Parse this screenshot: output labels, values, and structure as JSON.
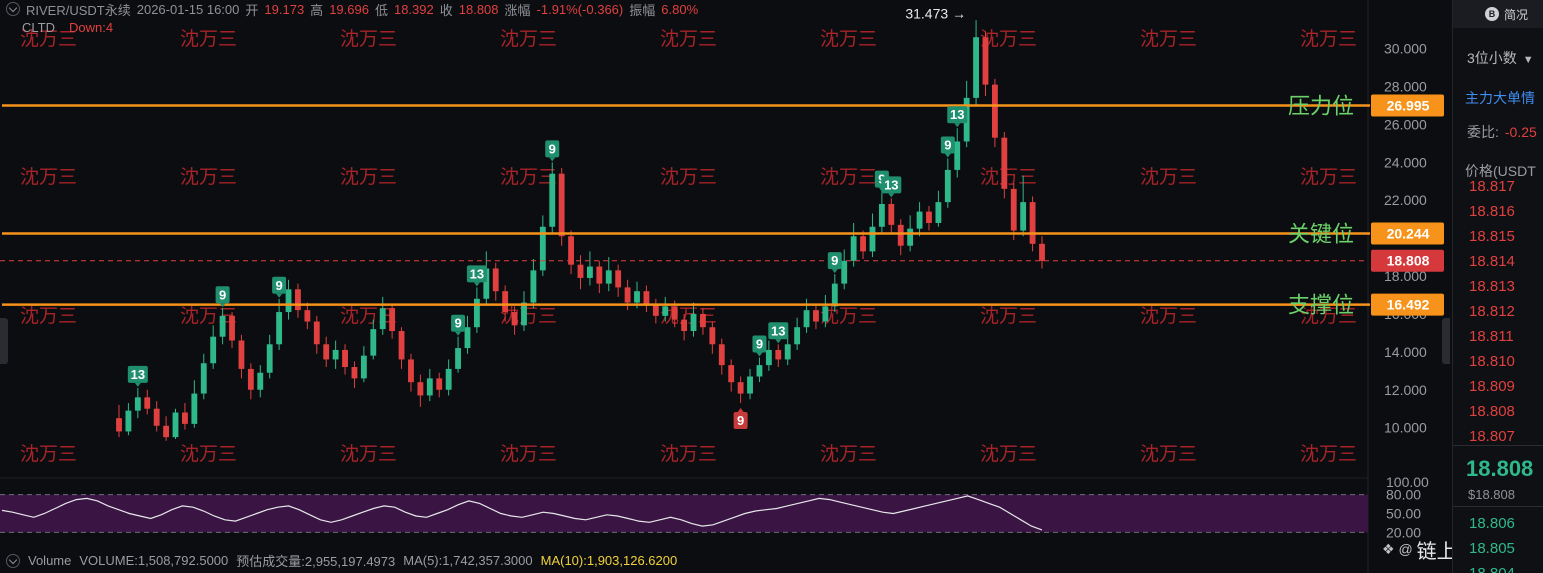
{
  "header": {
    "symbol": "RIVER/USDT永续",
    "datetime": "2026-01-15 16:00",
    "open_label": "开",
    "open": "19.173",
    "high_label": "高",
    "high": "19.696",
    "low_label": "低",
    "low": "18.392",
    "close_label": "收",
    "close": "18.808",
    "change_label": "涨幅",
    "change": "-1.91%(-0.366)",
    "amp_label": "振幅",
    "amp": "6.80%"
  },
  "indicator": {
    "name": "CLTD",
    "down": "Down:4"
  },
  "volume": {
    "label": "Volume",
    "volume": "VOLUME:1,508,792.5000",
    "est": "预估成交量:2,955,197.4973",
    "ma5": "MA(5):1,742,357.3000",
    "ma10": "MA(10):1,903,126.6200"
  },
  "watermark": "沈万三",
  "brand": "链上城主",
  "right_panel": {
    "top_button": "简况",
    "decimals": "3位小数",
    "main_order": "主力大单情",
    "weibi_label": "委比:",
    "weibi_value": "-0.25",
    "price_header": "价格(USDT",
    "asks": [
      "18.817",
      "18.816",
      "18.815",
      "18.814",
      "18.813",
      "18.812",
      "18.811",
      "18.810",
      "18.809",
      "18.808",
      "18.807"
    ],
    "last_price": "18.808",
    "last_usd": "$18.808",
    "bids": [
      "18.806",
      "18.805",
      "18.804"
    ]
  },
  "colors": {
    "up": "#2fb98a",
    "down": "#e0403f",
    "level": "#f7931a",
    "rsi_fill": "#3a1442"
  },
  "chart_data": {
    "type": "candlestick",
    "ylim": [
      8.4,
      32.3
    ],
    "price_ticks": [
      "30.000",
      "28.000",
      "26.000",
      "24.000",
      "22.000",
      "20.000",
      "18.000",
      "16.000",
      "14.000",
      "12.000",
      "10.000"
    ],
    "levels": [
      {
        "label": "压力位",
        "value": 26.995,
        "text": "26.995"
      },
      {
        "label": "关键位",
        "value": 20.244,
        "text": "20.244"
      },
      {
        "label": "支撑位",
        "value": 16.492,
        "text": "16.492"
      }
    ],
    "current": {
      "value": 18.808,
      "text": "18.808"
    },
    "high_marker": {
      "text": "31.473 →",
      "value": 31.473
    },
    "candles": [
      [
        0,
        10.5,
        9.8,
        11.2,
        9.5
      ],
      [
        1,
        9.8,
        10.9,
        11.3,
        9.6
      ],
      [
        2,
        10.9,
        11.6,
        12.1,
        10.5
      ],
      [
        3,
        11.6,
        11.0,
        12.0,
        10.7
      ],
      [
        4,
        11.0,
        10.1,
        11.4,
        9.8
      ],
      [
        5,
        10.1,
        9.5,
        10.6,
        9.3
      ],
      [
        6,
        9.5,
        10.8,
        11.0,
        9.4
      ],
      [
        7,
        10.8,
        10.2,
        11.3,
        9.9
      ],
      [
        8,
        10.2,
        11.8,
        12.5,
        10.0
      ],
      [
        9,
        11.8,
        13.4,
        13.9,
        11.5
      ],
      [
        10,
        13.4,
        14.8,
        15.4,
        13.1
      ],
      [
        11,
        14.8,
        15.9,
        16.3,
        14.4
      ],
      [
        12,
        15.9,
        14.6,
        16.1,
        14.2
      ],
      [
        13,
        14.6,
        13.1,
        14.9,
        12.6
      ],
      [
        14,
        13.1,
        12.0,
        13.4,
        11.5
      ],
      [
        15,
        12.0,
        12.9,
        13.3,
        11.6
      ],
      [
        16,
        12.9,
        14.4,
        14.9,
        12.6
      ],
      [
        17,
        14.4,
        16.1,
        16.8,
        14.1
      ],
      [
        18,
        16.1,
        17.3,
        17.8,
        15.7
      ],
      [
        19,
        17.3,
        16.2,
        17.6,
        15.8
      ],
      [
        20,
        16.2,
        15.6,
        16.6,
        15.2
      ],
      [
        21,
        15.6,
        14.4,
        15.9,
        13.9
      ],
      [
        22,
        14.4,
        13.6,
        14.8,
        13.2
      ],
      [
        23,
        13.6,
        14.1,
        14.6,
        13.1
      ],
      [
        24,
        14.1,
        13.2,
        14.4,
        12.8
      ],
      [
        25,
        13.2,
        12.6,
        13.5,
        12.1
      ],
      [
        26,
        12.6,
        13.8,
        14.3,
        12.4
      ],
      [
        27,
        13.8,
        15.2,
        15.7,
        13.6
      ],
      [
        28,
        15.2,
        16.3,
        16.9,
        14.9
      ],
      [
        29,
        16.3,
        15.1,
        16.5,
        14.7
      ],
      [
        30,
        15.1,
        13.6,
        15.3,
        13.1
      ],
      [
        31,
        13.6,
        12.4,
        13.9,
        11.9
      ],
      [
        32,
        12.4,
        11.7,
        12.8,
        11.1
      ],
      [
        33,
        11.7,
        12.6,
        13.1,
        11.4
      ],
      [
        34,
        12.6,
        12.0,
        12.9,
        11.6
      ],
      [
        35,
        12.0,
        13.1,
        13.6,
        11.7
      ],
      [
        36,
        13.1,
        14.2,
        14.8,
        12.9
      ],
      [
        37,
        14.2,
        15.3,
        15.9,
        13.9
      ],
      [
        38,
        15.3,
        16.8,
        17.4,
        15.0
      ],
      [
        39,
        16.8,
        18.4,
        19.3,
        16.5
      ],
      [
        40,
        18.4,
        17.2,
        18.7,
        16.7
      ],
      [
        41,
        17.2,
        16.1,
        17.5,
        15.6
      ],
      [
        42,
        16.1,
        15.4,
        16.4,
        14.9
      ],
      [
        43,
        15.4,
        16.6,
        17.2,
        15.1
      ],
      [
        44,
        16.6,
        18.3,
        18.9,
        16.3
      ],
      [
        45,
        18.3,
        20.6,
        21.2,
        18.0
      ],
      [
        46,
        20.6,
        23.4,
        24.0,
        20.2
      ],
      [
        47,
        23.4,
        20.1,
        23.7,
        19.6
      ],
      [
        48,
        20.1,
        18.6,
        20.4,
        18.1
      ],
      [
        49,
        18.6,
        17.9,
        19.1,
        17.3
      ],
      [
        50,
        17.9,
        18.5,
        19.3,
        17.5
      ],
      [
        51,
        18.5,
        17.6,
        18.8,
        17.1
      ],
      [
        52,
        17.6,
        18.3,
        19.0,
        17.2
      ],
      [
        53,
        18.3,
        17.4,
        18.6,
        16.9
      ],
      [
        54,
        17.4,
        16.6,
        17.8,
        16.2
      ],
      [
        55,
        16.6,
        17.2,
        17.7,
        16.3
      ],
      [
        56,
        17.2,
        16.5,
        17.5,
        16.1
      ],
      [
        57,
        16.5,
        15.9,
        16.8,
        15.5
      ],
      [
        58,
        15.9,
        16.4,
        16.9,
        15.6
      ],
      [
        59,
        16.4,
        15.7,
        16.7,
        15.3
      ],
      [
        60,
        15.7,
        15.1,
        16.0,
        14.6
      ],
      [
        61,
        15.1,
        16.0,
        16.6,
        14.8
      ],
      [
        62,
        16.0,
        15.3,
        16.3,
        14.9
      ],
      [
        63,
        15.3,
        14.4,
        15.6,
        13.9
      ],
      [
        64,
        14.4,
        13.3,
        14.7,
        12.8
      ],
      [
        65,
        13.3,
        12.4,
        13.6,
        11.9
      ],
      [
        66,
        12.4,
        11.8,
        12.7,
        11.3
      ],
      [
        67,
        11.8,
        12.7,
        13.1,
        11.5
      ],
      [
        68,
        12.7,
        13.3,
        13.7,
        12.4
      ],
      [
        69,
        13.3,
        14.1,
        14.6,
        13.0
      ],
      [
        70,
        14.1,
        13.6,
        14.4,
        13.2
      ],
      [
        71,
        13.6,
        14.4,
        14.9,
        13.3
      ],
      [
        72,
        14.4,
        15.3,
        15.8,
        14.1
      ],
      [
        73,
        15.3,
        16.2,
        16.8,
        15.0
      ],
      [
        74,
        16.2,
        15.6,
        16.5,
        15.2
      ],
      [
        75,
        15.6,
        16.4,
        17.0,
        15.3
      ],
      [
        76,
        16.4,
        17.6,
        18.1,
        16.1
      ],
      [
        77,
        17.6,
        18.8,
        19.4,
        17.3
      ],
      [
        78,
        18.8,
        20.1,
        20.8,
        18.5
      ],
      [
        79,
        20.1,
        19.3,
        20.4,
        18.9
      ],
      [
        80,
        19.3,
        20.6,
        21.3,
        19.0
      ],
      [
        81,
        20.6,
        21.8,
        22.4,
        20.3
      ],
      [
        82,
        21.8,
        20.7,
        22.1,
        20.2
      ],
      [
        83,
        20.7,
        19.6,
        21.0,
        19.1
      ],
      [
        84,
        19.6,
        20.5,
        21.2,
        19.3
      ],
      [
        85,
        20.5,
        21.4,
        21.9,
        20.1
      ],
      [
        86,
        21.4,
        20.8,
        21.7,
        20.4
      ],
      [
        87,
        20.8,
        21.9,
        22.5,
        20.6
      ],
      [
        88,
        21.9,
        23.6,
        24.2,
        21.6
      ],
      [
        89,
        23.6,
        25.1,
        25.8,
        23.2
      ],
      [
        90,
        25.1,
        27.4,
        28.3,
        24.8
      ],
      [
        91,
        27.4,
        30.6,
        31.5,
        27.0
      ],
      [
        92,
        30.6,
        28.1,
        30.9,
        27.5
      ],
      [
        93,
        28.1,
        25.3,
        28.4,
        24.8
      ],
      [
        94,
        25.3,
        22.6,
        25.6,
        22.1
      ],
      [
        95,
        22.6,
        20.4,
        22.9,
        19.9
      ],
      [
        96,
        20.4,
        21.9,
        23.3,
        20.1
      ],
      [
        97,
        21.9,
        19.7,
        22.2,
        19.3
      ],
      [
        98,
        19.7,
        18.8,
        20.1,
        18.4
      ]
    ],
    "markers": [
      {
        "i": 2,
        "text": "13",
        "kind": "up"
      },
      {
        "i": 11,
        "text": "9",
        "kind": "up"
      },
      {
        "i": 17,
        "text": "9",
        "kind": "up"
      },
      {
        "i": 36,
        "text": "9",
        "kind": "up"
      },
      {
        "i": 38,
        "text": "13",
        "kind": "up"
      },
      {
        "i": 46,
        "text": "9",
        "kind": "up"
      },
      {
        "i": 66,
        "text": "9",
        "kind": "down"
      },
      {
        "i": 68,
        "text": "9",
        "kind": "up"
      },
      {
        "i": 70,
        "text": "13",
        "kind": "up"
      },
      {
        "i": 76,
        "text": "9",
        "kind": "up"
      },
      {
        "i": 81,
        "text": "9",
        "kind": "up"
      },
      {
        "i": 82,
        "text": "13",
        "kind": "up"
      },
      {
        "i": 88,
        "text": "9",
        "kind": "up"
      },
      {
        "i": 89,
        "text": "13",
        "kind": "up"
      }
    ],
    "rsi": {
      "ylim": [
        0,
        100
      ],
      "ticks": [
        "100.00",
        "80.00",
        "50.00",
        "20.00"
      ],
      "bands": [
        80,
        20
      ],
      "values": [
        55,
        52,
        48,
        44,
        50,
        58,
        66,
        72,
        74,
        70,
        62,
        56,
        50,
        46,
        42,
        48,
        56,
        62,
        60,
        54,
        46,
        40,
        38,
        44,
        50,
        56,
        60,
        62,
        56,
        48,
        40,
        36,
        40,
        46,
        52,
        58,
        62,
        60,
        52,
        46,
        44,
        50,
        56,
        64,
        70,
        66,
        58,
        50,
        46,
        44,
        48,
        52,
        50,
        46,
        42,
        40,
        44,
        48,
        46,
        42,
        38,
        36,
        40,
        44,
        40,
        34,
        30,
        32,
        38,
        44,
        50,
        54,
        56,
        58,
        62,
        66,
        70,
        74,
        72,
        68,
        64,
        60,
        56,
        52,
        50,
        54,
        58,
        62,
        66,
        70,
        74,
        78,
        72,
        66,
        60,
        50,
        40,
        30,
        24
      ]
    }
  }
}
